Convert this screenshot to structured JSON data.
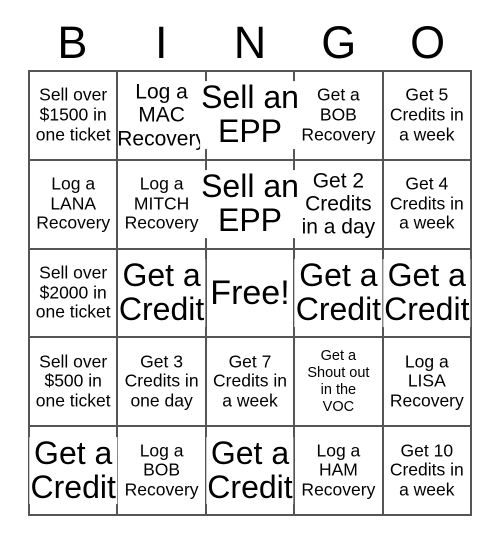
{
  "card": {
    "title": "BINGO",
    "headers": [
      "B",
      "I",
      "N",
      "G",
      "O"
    ],
    "free_space_label": "Free!",
    "grid_line_color": "#555555",
    "text_color": "#000000",
    "background_color": "#ffffff",
    "rows": 5,
    "columns": 5,
    "cells": [
      {
        "text": "Sell over\n$1500 in\none ticket",
        "size": "small"
      },
      {
        "text": "Log a\nMAC\nRecovery",
        "size": "medium"
      },
      {
        "text": "Sell an\nEPP",
        "size": "large"
      },
      {
        "text": "Get a\nBOB\nRecovery",
        "size": "small"
      },
      {
        "text": "Get 5\nCredits in\na week",
        "size": "small"
      },
      {
        "text": "Log a\nLANA\nRecovery",
        "size": "small"
      },
      {
        "text": "Log a\nMITCH\nRecovery",
        "size": "small"
      },
      {
        "text": "Sell an\nEPP",
        "size": "large"
      },
      {
        "text": "Get 2\nCredits\nin a day",
        "size": "medium"
      },
      {
        "text": "Get 4\nCredits in\na week",
        "size": "small"
      },
      {
        "text": "Sell over\n$2000 in\none ticket",
        "size": "small"
      },
      {
        "text": "Get a\nCredit",
        "size": "large"
      },
      {
        "text": "Free!",
        "size": "huge"
      },
      {
        "text": "Get a\nCredit",
        "size": "large"
      },
      {
        "text": "Get a\nCredit",
        "size": "large"
      },
      {
        "text": "Sell over\n$500 in\none ticket",
        "size": "small"
      },
      {
        "text": "Get 3\nCredits in\none day",
        "size": "small"
      },
      {
        "text": "Get 7\nCredits in\na week",
        "size": "small"
      },
      {
        "text": "Get a\nShout out\nin the\nVOC",
        "size": "tiny"
      },
      {
        "text": "Log a\nLISA\nRecovery",
        "size": "small"
      },
      {
        "text": "Get a\nCredit",
        "size": "large"
      },
      {
        "text": "Log a\nBOB\nRecovery",
        "size": "small"
      },
      {
        "text": "Get a\nCredit",
        "size": "large"
      },
      {
        "text": "Log a\nHAM\nRecovery",
        "size": "small"
      },
      {
        "text": "Get 10\nCredits in\na week",
        "size": "small"
      }
    ]
  }
}
